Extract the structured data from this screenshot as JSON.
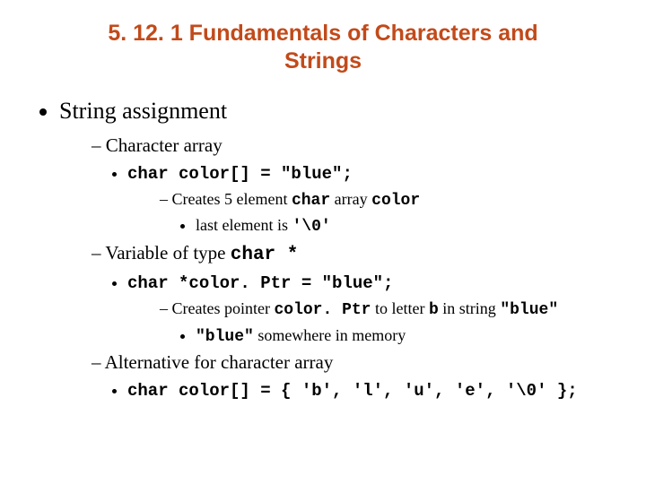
{
  "title": "5. 12. 1 Fundamentals of Characters and Strings",
  "b1": "String assignment",
  "b1_1": "Character array",
  "b1_1_1_code": "char color[] = \"blue\";",
  "b1_1_1_1a": "Creates 5 element ",
  "b1_1_1_1b": "char",
  "b1_1_1_1c": " array ",
  "b1_1_1_1d": "color",
  "b1_1_1_1_1a": "last element is ",
  "b1_1_1_1_1b": "'\\0'",
  "b1_2a": "Variable of type ",
  "b1_2b": "char *",
  "b1_2_1_code": "char *color. Ptr = \"blue\";",
  "b1_2_1_1a": "Creates pointer ",
  "b1_2_1_1b": "color. Ptr",
  "b1_2_1_1c": " to letter ",
  "b1_2_1_1d": "b",
  "b1_2_1_1e": " in string ",
  "b1_2_1_1f": "\"blue\"",
  "b1_2_1_1_1a": "\"blue\"",
  "b1_2_1_1_1b": " somewhere in memory",
  "b1_3": "Alternative for character array",
  "b1_3_1_code": "char color[] = { 'b', 'l', 'u', 'e', '\\0' };"
}
